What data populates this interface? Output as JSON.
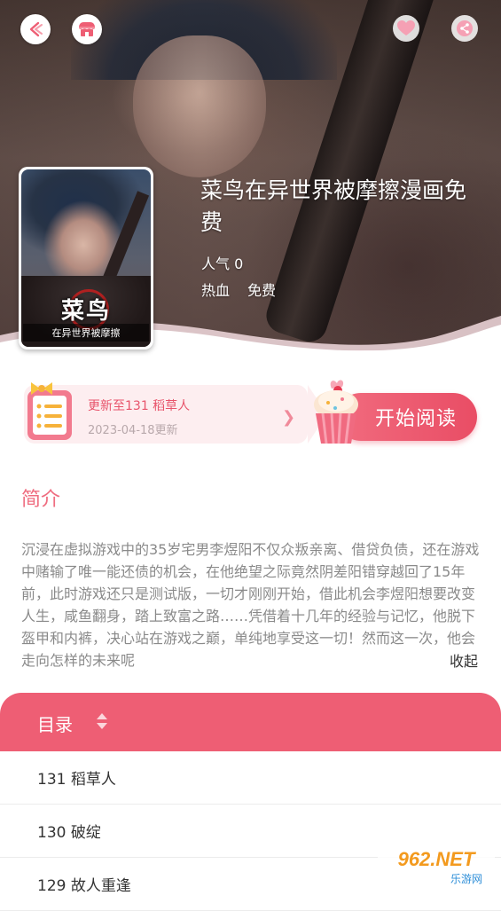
{
  "header": {
    "back_icon": "back-arrow-icon",
    "shop_icon": "shop-icon",
    "favorite_icon": "heart-icon",
    "share_icon": "share-icon"
  },
  "comic": {
    "title": "菜鸟在异世界被摩擦漫画免费",
    "popularity": "人气 0",
    "tags": [
      "热血",
      "免费"
    ],
    "cover_logo": "菜鸟",
    "cover_subtitle": "在异世界被摩擦"
  },
  "update": {
    "latest": "更新至131 稻草人",
    "date": "2023-04-18更新"
  },
  "read_button": {
    "label": "开始阅读"
  },
  "intro": {
    "heading": "简介",
    "text": "沉浸在虚拟游戏中的35岁宅男李煜阳不仅众叛亲离、借贷负债，还在游戏中赌输了唯一能还债的机会，在他绝望之际竟然阴差阳错穿越回了15年前，此时游戏还只是测试版，一切才刚刚开始，借此机会李煜阳想要改变人生，咸鱼翻身，踏上致富之路……凭借着十几年的经验与记忆，他脱下盔甲和内裤，决心站在游戏之巅，单纯地享受这一切！然而这一次，他会走向怎样的未来呢",
    "collapse_label": "收起"
  },
  "toc": {
    "title": "目录",
    "chapters": [
      "131 稻草人",
      "130 破绽",
      "129 故人重逢"
    ]
  },
  "watermark": {
    "main": "962.NET",
    "sub": "乐游网"
  },
  "colors": {
    "accent": "#ee5e74",
    "intro_heading": "#ef6d80",
    "update_bg": "#fdeef0"
  }
}
